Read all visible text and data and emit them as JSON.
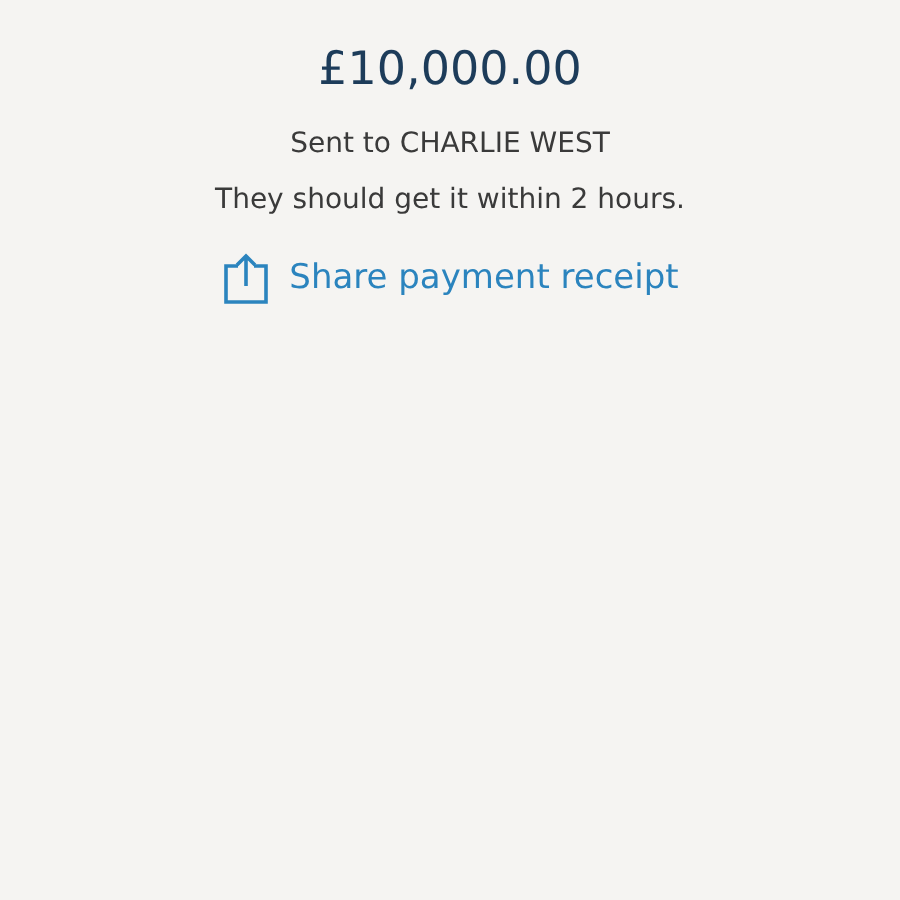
{
  "amount": "£10,000.00",
  "recipient": "Sent to CHARLIE WEST",
  "message": "They should get it within 2 hours.",
  "share_link": {
    "label": "Share payment receipt"
  }
}
